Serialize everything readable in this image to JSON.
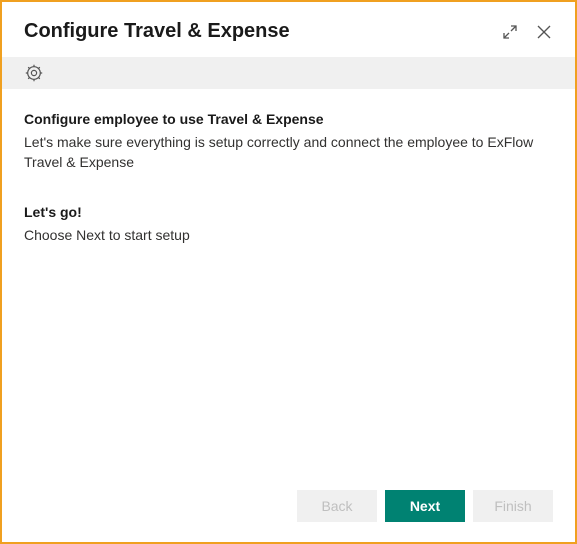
{
  "header": {
    "title": "Configure Travel & Expense"
  },
  "content": {
    "heading1": "Configure employee to use Travel & Expense",
    "desc1": "Let's make sure everything is setup correctly and connect the employee to ExFlow Travel & Expense",
    "heading2": "Let's go!",
    "desc2": "Choose Next to start setup"
  },
  "footer": {
    "back": "Back",
    "next": "Next",
    "finish": "Finish"
  }
}
